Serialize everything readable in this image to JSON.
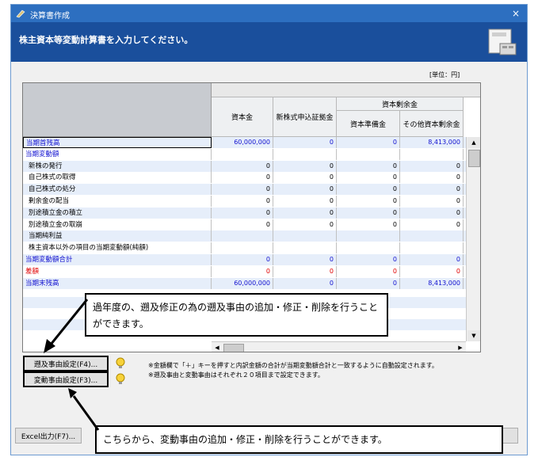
{
  "window": {
    "title": "決算書作成",
    "close_glyph": "×"
  },
  "banner": {
    "heading": "株主資本等変動計算書を入力してください。"
  },
  "unit_label": "[単位：円]",
  "table": {
    "header_group": "資本剰余金",
    "columns": [
      "資本金",
      "新株式申込証拠金",
      "資本準備金",
      "その他資本剰余金"
    ],
    "rows": [
      {
        "label": "当期首残高",
        "style": "blue",
        "values": [
          "60,000,000",
          "0",
          "0",
          "8,413,000"
        ]
      },
      {
        "label": "当期変動額",
        "style": "blue",
        "values": [
          "",
          "",
          "",
          ""
        ]
      },
      {
        "label": "新株の発行",
        "style": "",
        "values": [
          "0",
          "0",
          "0",
          "0"
        ]
      },
      {
        "label": "自己株式の取得",
        "style": "",
        "values": [
          "0",
          "0",
          "0",
          "0"
        ]
      },
      {
        "label": "自己株式の処分",
        "style": "",
        "values": [
          "0",
          "0",
          "0",
          "0"
        ]
      },
      {
        "label": "剰余金の配当",
        "style": "",
        "values": [
          "0",
          "0",
          "0",
          "0"
        ]
      },
      {
        "label": "別途積立金の積立",
        "style": "",
        "values": [
          "0",
          "0",
          "0",
          "0"
        ]
      },
      {
        "label": "別途積立金の取崩",
        "style": "",
        "values": [
          "0",
          "0",
          "0",
          "0"
        ]
      },
      {
        "label": "当期純利益",
        "style": "",
        "values": [
          "",
          "",
          "",
          ""
        ]
      },
      {
        "label": "株主資本以外の項目の当期変動額(純額)",
        "style": "",
        "values": [
          "",
          "",
          "",
          ""
        ]
      },
      {
        "label": "当期変動額合計",
        "style": "blue",
        "values": [
          "0",
          "0",
          "0",
          "0"
        ]
      },
      {
        "label": "差額",
        "style": "red",
        "values": [
          "0",
          "0",
          "0",
          "0"
        ]
      },
      {
        "label": "当期末残高",
        "style": "blue",
        "values": [
          "60,000,000",
          "0",
          "0",
          "8,413,000"
        ]
      }
    ]
  },
  "buttons": {
    "retro": "遡及事由設定(F4)...",
    "change": "変動事由設定(F3)...",
    "excel": "Excel出力(F7)..."
  },
  "notes": [
    "※金額欄で「＋」キーを押すと内訳金額の合計が当期変動額合計と一致するように自動設定されます。",
    "※遡及事由と変動事由はそれぞれ２０項目まで設定できます。"
  ],
  "callouts": {
    "top": "過年度の、遡及修正の為の遡及事由の追加・修正・削除を行うことができます。",
    "bottom": "こちらから、変動事由の追加・修正・削除を行うことができます。"
  }
}
